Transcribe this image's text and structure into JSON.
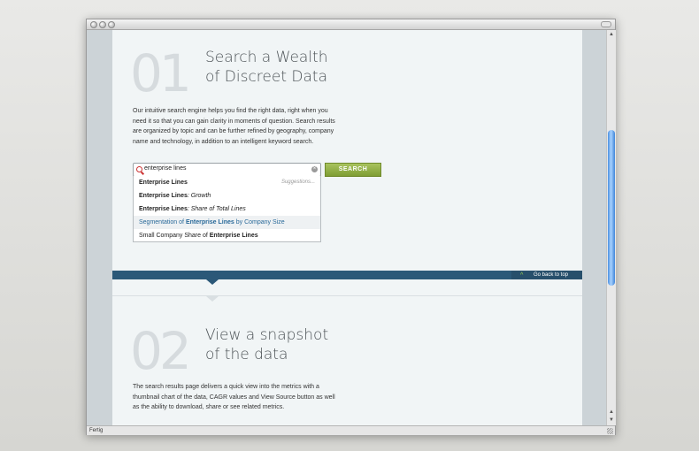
{
  "window": {
    "status_text": "Fertig"
  },
  "step1": {
    "number": "01",
    "title_line1": "Search a Wealth",
    "title_line2": "of Discreet Data",
    "description": [
      "Our intuitive search engine helps you find the right data, right when you",
      "need it so that you can gain clarity in moments of question. Search results",
      "are organized by topic and can be further refined by geography, company",
      "name and technology, in addition to an intelligent keyword search."
    ]
  },
  "search": {
    "query": "enterprise lines",
    "button_label": "SEARCH",
    "suggestions_note": "Suggestions...",
    "suggestions": [
      {
        "before": "",
        "bold": "Enterprise Lines",
        "after": ""
      },
      {
        "before": "",
        "bold": "Enterprise Lines",
        "after": ": Growth"
      },
      {
        "before": "",
        "bold": "Enterprise Lines",
        "after": ": Share of Total Lines"
      },
      {
        "before": "Segmentation of ",
        "bold": "Enterprise Lines",
        "after": " by Company Size"
      },
      {
        "before": "Small Company Share of ",
        "bold": "Enterprise Lines",
        "after": ""
      }
    ],
    "selected_index": 3
  },
  "band": {
    "back_to_top": "Go back to top"
  },
  "step2": {
    "number": "02",
    "title_line1": "View a snapshot",
    "title_line2": "of the data",
    "description": [
      "The search results page delivers a quick view into the metrics with a",
      "thumbnail chart of the data, CAGR values and View Source button as well",
      "as the ability to download, share or see related metrics."
    ]
  },
  "colors": {
    "band": "#2b5878",
    "button": "#8eab3f",
    "link": "#2a6a9a"
  }
}
